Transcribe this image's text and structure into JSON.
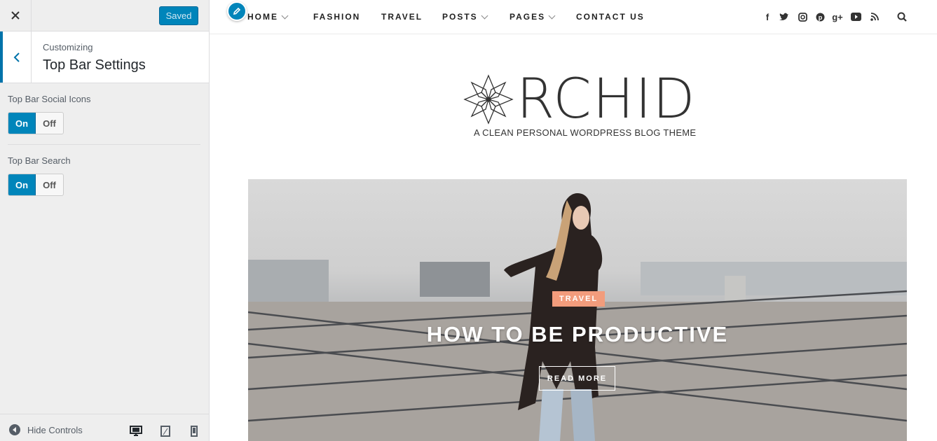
{
  "sidebar": {
    "saved_label": "Saved",
    "customizing_label": "Customizing",
    "section_title": "Top Bar Settings",
    "controls": [
      {
        "label": "Top Bar Social Icons",
        "on": "On",
        "off": "Off",
        "value": "On"
      },
      {
        "label": "Top Bar Search",
        "on": "On",
        "off": "Off",
        "value": "On"
      }
    ],
    "footer": {
      "hide_controls": "Hide Controls"
    }
  },
  "preview": {
    "nav": [
      {
        "label": "HOME",
        "has_dropdown": true
      },
      {
        "label": "FASHION",
        "has_dropdown": false
      },
      {
        "label": "TRAVEL",
        "has_dropdown": false
      },
      {
        "label": "POSTS",
        "has_dropdown": true
      },
      {
        "label": "PAGES",
        "has_dropdown": true
      },
      {
        "label": "CONTACT US",
        "has_dropdown": false
      }
    ],
    "social_icons": [
      "facebook-icon",
      "twitter-icon",
      "instagram-icon",
      "pinterest-icon",
      "google-plus-icon",
      "youtube-icon",
      "rss-icon",
      "search-icon"
    ],
    "logo": {
      "text": "RCHID",
      "tagline": "A CLEAN PERSONAL WORDPRESS BLOG THEME"
    },
    "hero": {
      "category": "TRAVEL",
      "title": "HOW TO BE PRODUCTIVE",
      "button": "READ MORE"
    }
  },
  "colors": {
    "accent": "#0085ba",
    "category_badge": "#f29c7c",
    "sidebar_bg": "#eeeeee"
  }
}
